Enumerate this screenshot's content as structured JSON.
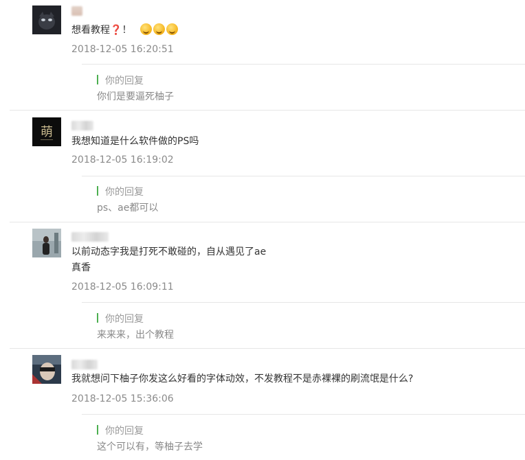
{
  "theme": {
    "accent": "#4caf50",
    "divider": "#e6e6e6",
    "time_color": "#8a8a8a"
  },
  "comments": [
    {
      "text_main": "想看教程",
      "text_qmark": "❓",
      "text_after": "！",
      "emojis": [
        "laugh-cry-emoji",
        "laugh-cry-emoji",
        "laugh-cry-emoji"
      ],
      "time": "2018-12-05 16:20:51",
      "reply_label": "你的回复",
      "reply_text": "你们是要逼死柚子"
    },
    {
      "text": "我想知道是什么软件做的PS吗",
      "time": "2018-12-05 16:19:02",
      "reply_label": "你的回复",
      "reply_text": "ps、ae都可以",
      "avatar_char": "萌"
    },
    {
      "text": "以前动态字我是打死不敢碰的，自从遇见了ae",
      "text2": "真香",
      "time": "2018-12-05 16:09:11",
      "reply_label": "你的回复",
      "reply_text": "来来来，出个教程"
    },
    {
      "text": "我就想问下柚子你发这么好看的字体动效，不发教程不是赤裸裸的刷流氓是什么?",
      "time": "2018-12-05 15:36:06",
      "reply_label": "你的回复",
      "reply_text": "这个可以有，等柚子去学"
    }
  ]
}
